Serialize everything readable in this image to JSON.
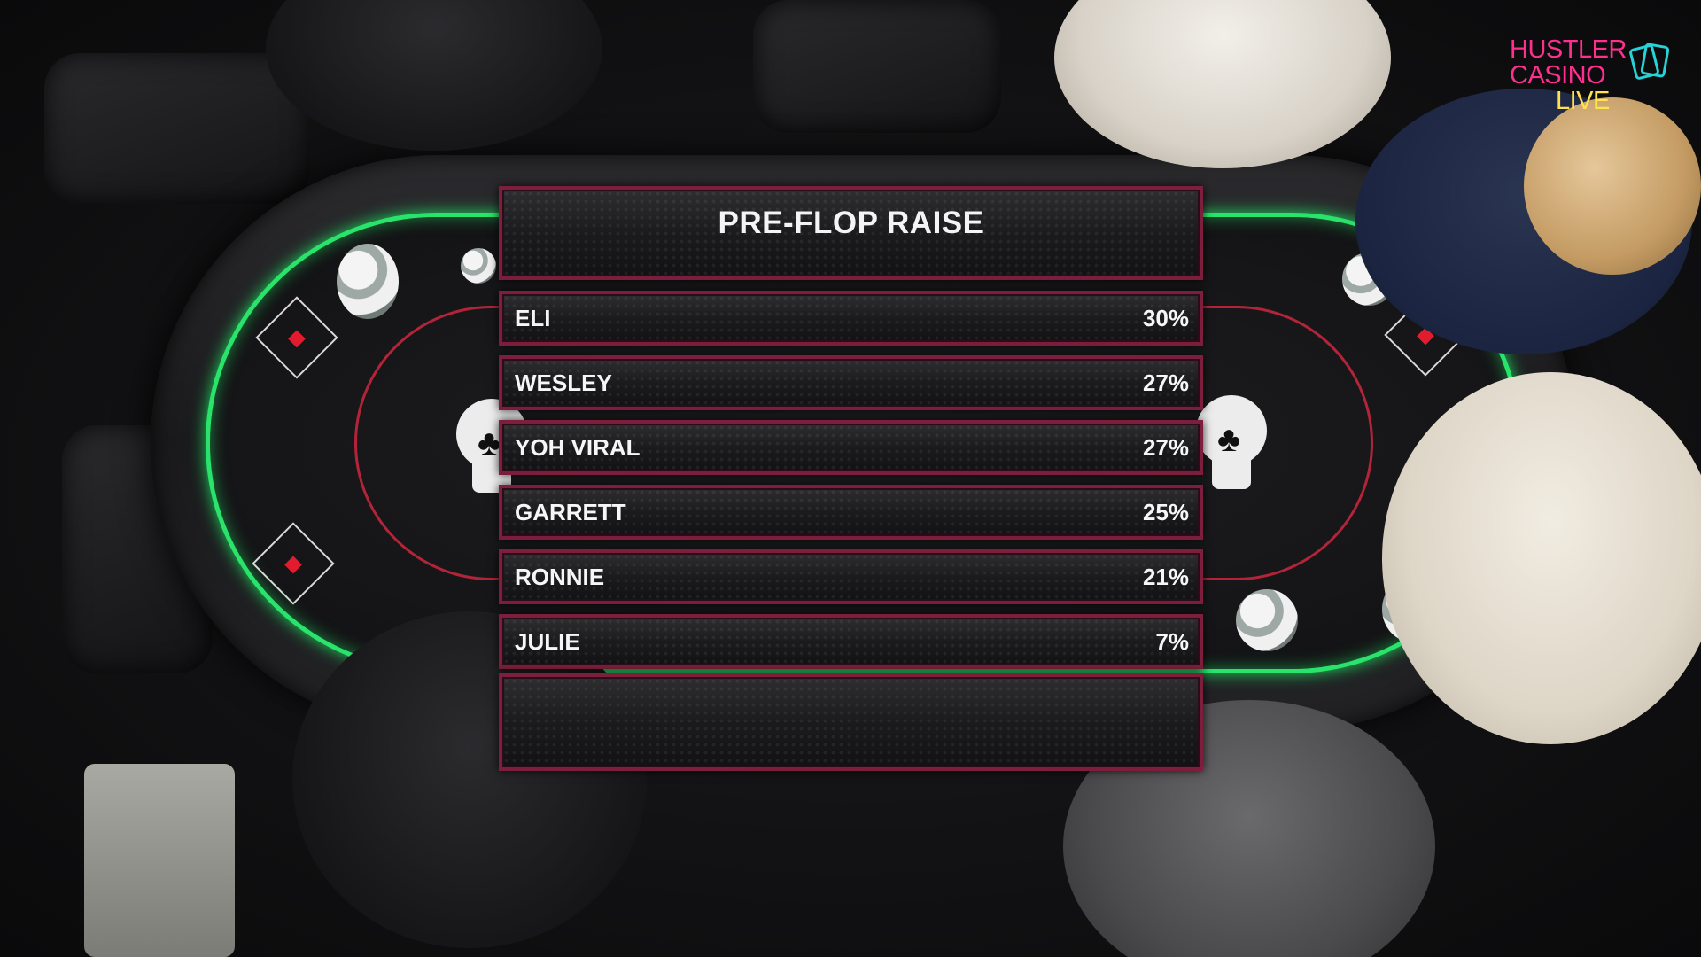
{
  "overlay": {
    "title": "PRE-FLOP RAISE",
    "players": [
      {
        "name": "ELI",
        "pct": "30%"
      },
      {
        "name": "WESLEY",
        "pct": "27%"
      },
      {
        "name": "YOH VIRAL",
        "pct": "27%"
      },
      {
        "name": "GARRETT",
        "pct": "25%"
      },
      {
        "name": "RONNIE",
        "pct": "21%"
      },
      {
        "name": "JULIE",
        "pct": "7%"
      }
    ]
  },
  "logo": {
    "line1": "HUSTLER",
    "line2": "CASINO",
    "line3": "LIVE",
    "icon": "playing-cards-icon"
  },
  "colors": {
    "felt_glow": "#29e36a",
    "bet_line": "#b32438",
    "panel_border": "#7d1f3c",
    "logo_pink": "#ff2f8f",
    "logo_yellow": "#ffe34d",
    "logo_cyan": "#27d3d8"
  }
}
